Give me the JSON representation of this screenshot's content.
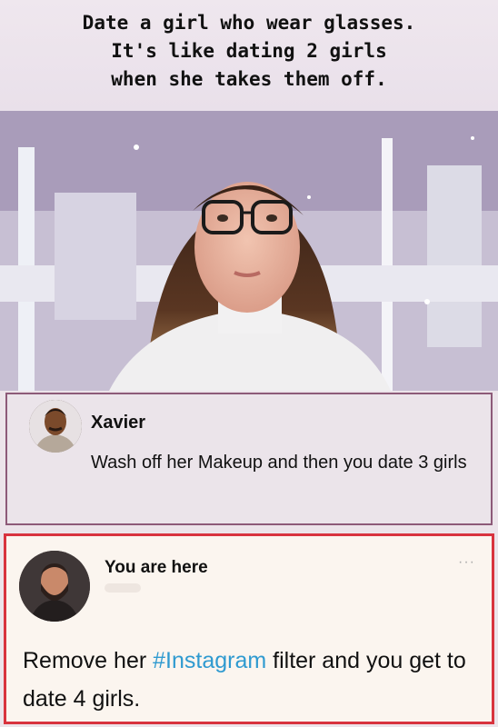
{
  "caption": {
    "line1": "Date a girl who wear glasses.",
    "line2": "It's like dating 2 girls",
    "line3": "when she takes them off."
  },
  "comment1": {
    "name": "Xavier",
    "text": "Wash off her Makeup and then you date 3 girls"
  },
  "comment2": {
    "name": "You are here",
    "more": "···",
    "text_before": "Remove her ",
    "hashtag": "#Instagram",
    "text_after": " filter and you get to date 4 girls."
  },
  "colors": {
    "highlight_border": "#d8333e",
    "hashtag": "#2f9ad0",
    "comment1_border": "#8d5a78"
  }
}
